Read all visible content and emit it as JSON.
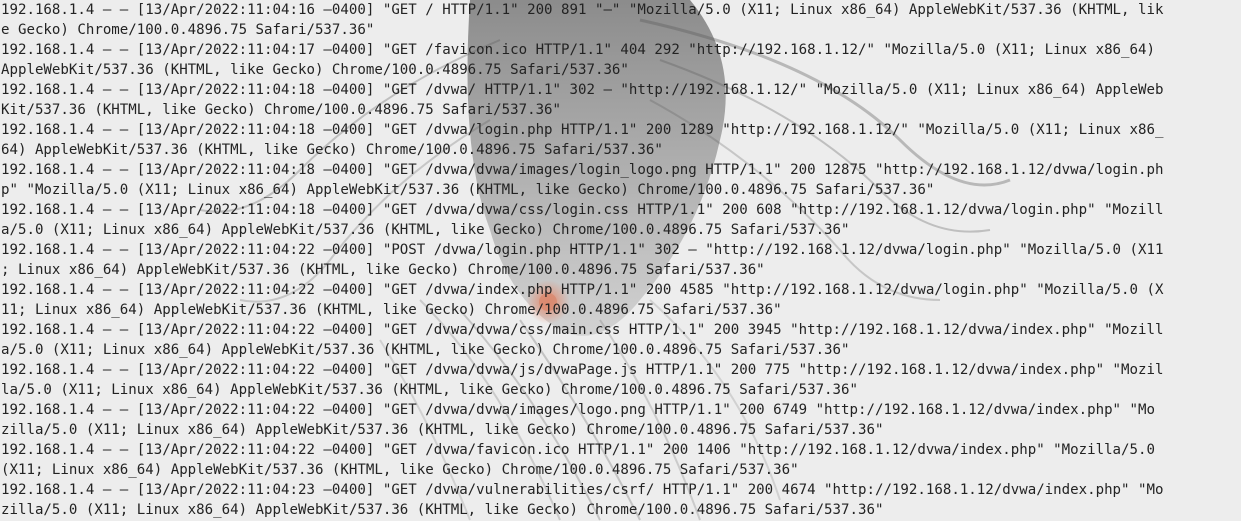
{
  "terminal": {
    "lines": [
      "192.168.1.4 – – [13/Apr/2022:11:04:16 –0400] \"GET / HTTP/1.1\" 200 891 \"–\" \"Mozilla/5.0 (X11; Linux x86_64) AppleWebKit/537.36 (KHTML, lik",
      "e Gecko) Chrome/100.0.4896.75 Safari/537.36\"",
      "192.168.1.4 – – [13/Apr/2022:11:04:17 –0400] \"GET /favicon.ico HTTP/1.1\" 404 292 \"http://192.168.1.12/\" \"Mozilla/5.0 (X11; Linux x86_64)",
      "AppleWebKit/537.36 (KHTML, like Gecko) Chrome/100.0.4896.75 Safari/537.36\"",
      "192.168.1.4 – – [13/Apr/2022:11:04:18 –0400] \"GET /dvwa/ HTTP/1.1\" 302 – \"http://192.168.1.12/\" \"Mozilla/5.0 (X11; Linux x86_64) AppleWeb",
      "Kit/537.36 (KHTML, like Gecko) Chrome/100.0.4896.75 Safari/537.36\"",
      "192.168.1.4 – – [13/Apr/2022:11:04:18 –0400] \"GET /dvwa/login.php HTTP/1.1\" 200 1289 \"http://192.168.1.12/\" \"Mozilla/5.0 (X11; Linux x86_",
      "64) AppleWebKit/537.36 (KHTML, like Gecko) Chrome/100.0.4896.75 Safari/537.36\"",
      "192.168.1.4 – – [13/Apr/2022:11:04:18 –0400] \"GET /dvwa/dvwa/images/login_logo.png HTTP/1.1\" 200 12875 \"http://192.168.1.12/dvwa/login.ph",
      "p\" \"Mozilla/5.0 (X11; Linux x86_64) AppleWebKit/537.36 (KHTML, like Gecko) Chrome/100.0.4896.75 Safari/537.36\"",
      "192.168.1.4 – – [13/Apr/2022:11:04:18 –0400] \"GET /dvwa/dvwa/css/login.css HTTP/1.1\" 200 608 \"http://192.168.1.12/dvwa/login.php\" \"Mozill",
      "a/5.0 (X11; Linux x86_64) AppleWebKit/537.36 (KHTML, like Gecko) Chrome/100.0.4896.75 Safari/537.36\"",
      "192.168.1.4 – – [13/Apr/2022:11:04:22 –0400] \"POST /dvwa/login.php HTTP/1.1\" 302 – \"http://192.168.1.12/dvwa/login.php\" \"Mozilla/5.0 (X11",
      "; Linux x86_64) AppleWebKit/537.36 (KHTML, like Gecko) Chrome/100.0.4896.75 Safari/537.36\"",
      "192.168.1.4 – – [13/Apr/2022:11:04:22 –0400] \"GET /dvwa/index.php HTTP/1.1\" 200 4585 \"http://192.168.1.12/dvwa/login.php\" \"Mozilla/5.0 (X",
      "11; Linux x86_64) AppleWebKit/537.36 (KHTML, like Gecko) Chrome/100.0.4896.75 Safari/537.36\"",
      "192.168.1.4 – – [13/Apr/2022:11:04:22 –0400] \"GET /dvwa/dvwa/css/main.css HTTP/1.1\" 200 3945 \"http://192.168.1.12/dvwa/index.php\" \"Mozill",
      "a/5.0 (X11; Linux x86_64) AppleWebKit/537.36 (KHTML, like Gecko) Chrome/100.0.4896.75 Safari/537.36\"",
      "192.168.1.4 – – [13/Apr/2022:11:04:22 –0400] \"GET /dvwa/dvwa/js/dvwaPage.js HTTP/1.1\" 200 775 \"http://192.168.1.12/dvwa/index.php\" \"Mozil",
      "la/5.0 (X11; Linux x86_64) AppleWebKit/537.36 (KHTML, like Gecko) Chrome/100.0.4896.75 Safari/537.36\"",
      "192.168.1.4 – – [13/Apr/2022:11:04:22 –0400] \"GET /dvwa/dvwa/images/logo.png HTTP/1.1\" 200 6749 \"http://192.168.1.12/dvwa/index.php\" \"Mo",
      "zilla/5.0 (X11; Linux x86_64) AppleWebKit/537.36 (KHTML, like Gecko) Chrome/100.0.4896.75 Safari/537.36\"",
      "192.168.1.4 – – [13/Apr/2022:11:04:22 –0400] \"GET /dvwa/favicon.ico HTTP/1.1\" 200 1406 \"http://192.168.1.12/dvwa/index.php\" \"Mozilla/5.0",
      "(X11; Linux x86_64) AppleWebKit/537.36 (KHTML, like Gecko) Chrome/100.0.4896.75 Safari/537.36\"",
      "192.168.1.4 – – [13/Apr/2022:11:04:23 –0400] \"GET /dvwa/vulnerabilities/csrf/ HTTP/1.1\" 200 4674 \"http://192.168.1.12/dvwa/index.php\" \"Mo",
      "zilla/5.0 (X11; Linux x86_64) AppleWebKit/537.36 (KHTML, like Gecko) Chrome/100.0.4896.75 Safari/537.36\""
    ]
  },
  "wallpaper": {
    "icon": "dragon-wallpaper-icon",
    "base_color": "#ededed",
    "ink_color": "#4a4a4a",
    "eye_color": "#d98a70"
  }
}
